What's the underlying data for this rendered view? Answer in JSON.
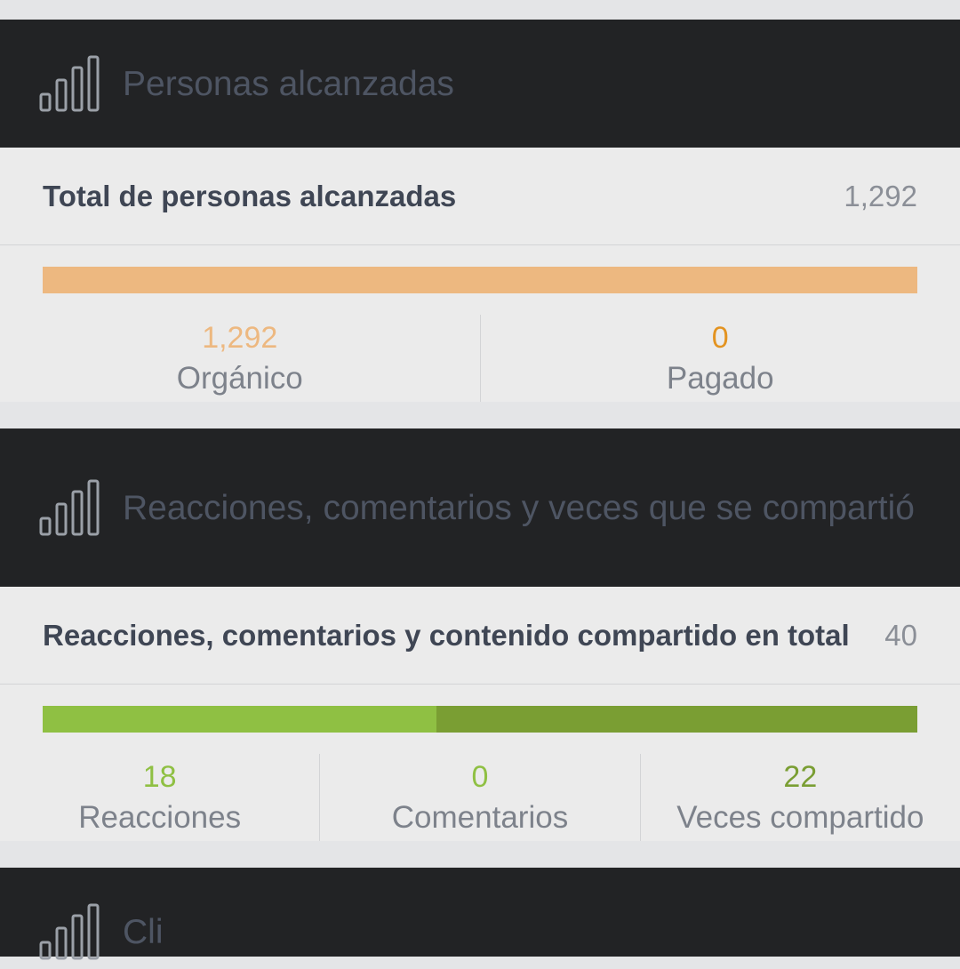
{
  "colors": {
    "header_bg": "#222325",
    "card_bg": "#ebebeb",
    "organic": "#edb880",
    "paid": "#e39320",
    "reactions": "#8fc043",
    "shares": "#7a9e33"
  },
  "icons": {
    "section_icon": "bar-chart-icon"
  },
  "reach": {
    "title": "Personas alcanzadas",
    "total_label": "Total de personas alcanzadas",
    "total_value": "1,292",
    "bar_fractions": {
      "organic": 1.0,
      "paid": 0.0
    },
    "stats": [
      {
        "value": "1,292",
        "label": "Orgánico"
      },
      {
        "value": "0",
        "label": "Pagado"
      }
    ]
  },
  "engagement": {
    "title": "Reacciones, comentarios y veces que se compartió",
    "total_label": "Reacciones, comentarios y contenido compartido en total",
    "total_value": "40",
    "bar_fractions": {
      "reactions": 0.45,
      "comments": 0.0,
      "shares": 0.55
    },
    "stats": [
      {
        "value": "18",
        "label": "Reacciones"
      },
      {
        "value": "0",
        "label": "Comentarios"
      },
      {
        "value": "22",
        "label": "Veces compartido"
      }
    ]
  },
  "next_section": {
    "title": "Cli"
  }
}
